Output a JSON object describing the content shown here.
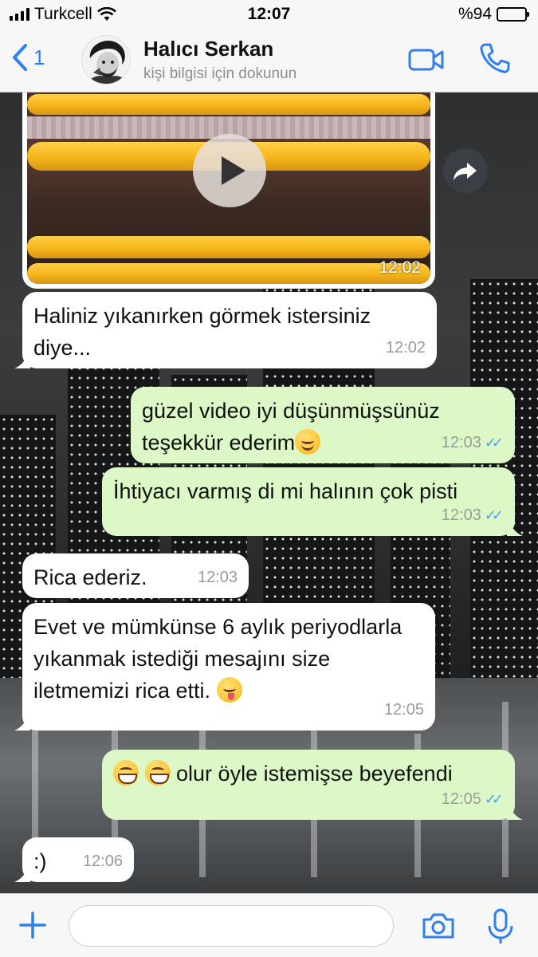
{
  "status_bar": {
    "carrier": "Turkcell",
    "time": "12:07",
    "battery": "%94",
    "battery_level": 0.94,
    "signal_icon": "signal-bars-icon",
    "wifi_icon": "wifi-icon"
  },
  "header": {
    "back_count": "1",
    "contact_name": "Halıcı Serkan",
    "subtitle": "kişi bilgisi için dokunun",
    "icons": [
      "back-chevron-icon",
      "video-call-icon",
      "phone-call-icon"
    ],
    "accent_color": "#2f80ed"
  },
  "video_message": {
    "time": "12:02",
    "play_icon": "play-icon",
    "forward_icon": "forward-icon"
  },
  "messages": [
    {
      "direction": "in",
      "text": "Haliniz yıkanırken görmek istersiniz diye...",
      "time": "12:02"
    },
    {
      "direction": "out",
      "text": "güzel video iyi düşünmüşsünüz teşekkür ederim",
      "emoji": "smiling-face",
      "time": "12:03",
      "read": true
    },
    {
      "direction": "out",
      "text": "İhtiyacı varmış di mi halının çok pisti",
      "time": "12:03",
      "read": true
    },
    {
      "direction": "in",
      "text": "Rica ederiz.",
      "time": "12:03"
    },
    {
      "direction": "in",
      "text": "Evet ve mümkünse 6 aylık periyodlarla yıkanmak istediği mesajını size iletmemizi rica etti.",
      "emoji": "savoring-food-face",
      "time": "12:05"
    },
    {
      "direction": "out",
      "text": "olur öyle istemişse beyefendi",
      "emoji_prefix": [
        "grinning-face",
        "grinning-face"
      ],
      "time": "12:05",
      "read": true
    },
    {
      "direction": "in",
      "text": ":)",
      "time": "12:06"
    }
  ],
  "read_ticks": "✓✓",
  "colors": {
    "incoming_bubble": "#ffffff",
    "outgoing_bubble": "#dcf8c6",
    "read_tick": "#4fa3f7"
  },
  "input_bar": {
    "placeholder": "",
    "icons": [
      "plus-icon",
      "camera-icon",
      "microphone-icon"
    ]
  }
}
